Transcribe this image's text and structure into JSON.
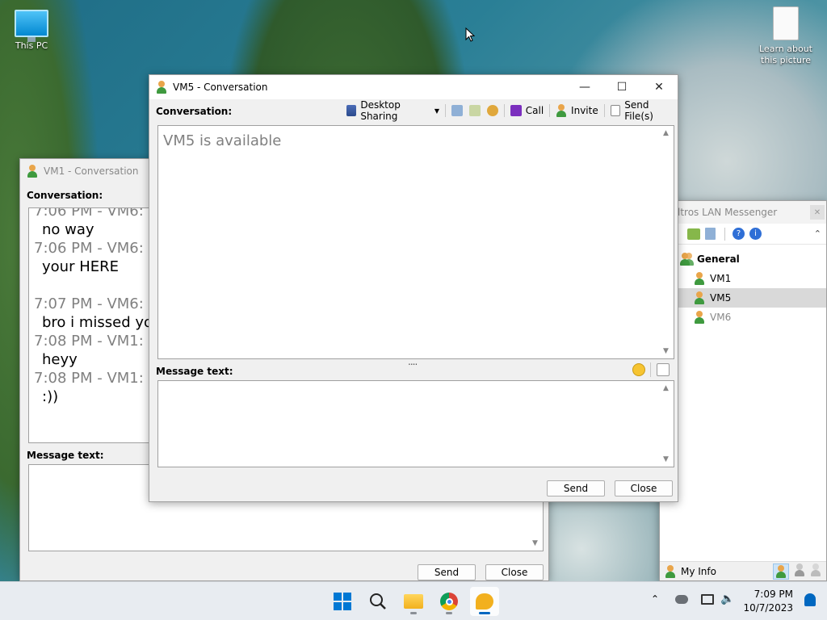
{
  "desktop": {
    "icons": [
      {
        "label": "This PC"
      },
      {
        "label": "Learn about this picture"
      }
    ]
  },
  "vm1_window": {
    "title": "VM1 - Conversation",
    "conversation_label": "Conversation:",
    "history": [
      {
        "meta": "7:06 PM - VM6:",
        "text": "no way"
      },
      {
        "meta": "7:06 PM - VM6:",
        "text": "your HERE"
      },
      {
        "meta": "7:07 PM - VM6:",
        "text": "bro i missed you"
      },
      {
        "meta": "7:08 PM - VM1:",
        "text": "heyy"
      },
      {
        "meta": "7:08 PM - VM1:",
        "text": ":))"
      }
    ],
    "message_label": "Message text:",
    "send_label": "Send",
    "close_label": "Close"
  },
  "vm5_window": {
    "title": "VM5 - Conversation",
    "conversation_label": "Conversation:",
    "toolbar": {
      "desktop_sharing": "Desktop Sharing",
      "call": "Call",
      "invite": "Invite",
      "send_files": "Send File(s)"
    },
    "status_text": "VM5 is available",
    "splitter": "....",
    "message_label": "Message text:",
    "send_label": "Send",
    "close_label": "Close"
  },
  "messenger": {
    "title": "ltros LAN Messenger",
    "group": "General",
    "users": [
      {
        "name": "VM1",
        "online": true
      },
      {
        "name": "VM5",
        "online": true
      },
      {
        "name": "VM6",
        "online": false
      }
    ],
    "my_info": "My Info"
  },
  "taskbar": {
    "time": "7:09 PM",
    "date": "10/7/2023"
  },
  "colors": {
    "accent": "#0067c0",
    "selection": "#d9d9d9"
  }
}
